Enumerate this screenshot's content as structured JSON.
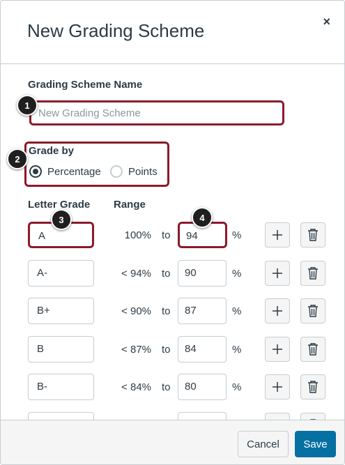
{
  "dialog": {
    "title": "New Grading Scheme",
    "close_symbol": "×"
  },
  "form": {
    "name_label": "Grading Scheme Name",
    "name_placeholder": "New Grading Scheme",
    "grade_by_label": "Grade by",
    "grade_by_options": [
      {
        "label": "Percentage",
        "selected": true
      },
      {
        "label": "Points",
        "selected": false
      }
    ]
  },
  "table": {
    "headers": {
      "letter_grade": "Letter Grade",
      "range": "Range"
    },
    "to_label": "to",
    "percent_symbol": "%",
    "rows": [
      {
        "letter": "A",
        "min": "100%",
        "max": "94"
      },
      {
        "letter": "A-",
        "min": "< 94%",
        "max": "90"
      },
      {
        "letter": "B+",
        "min": "< 90%",
        "max": "87"
      },
      {
        "letter": "B",
        "min": "< 87%",
        "max": "84"
      },
      {
        "letter": "B-",
        "min": "< 84%",
        "max": "80"
      }
    ]
  },
  "callouts": [
    "1",
    "2",
    "3",
    "4"
  ],
  "footer": {
    "cancel_label": "Cancel",
    "save_label": "Save"
  },
  "colors": {
    "highlight": "#8b1a2b",
    "primary": "#0770a3",
    "text": "#2d3b45"
  }
}
